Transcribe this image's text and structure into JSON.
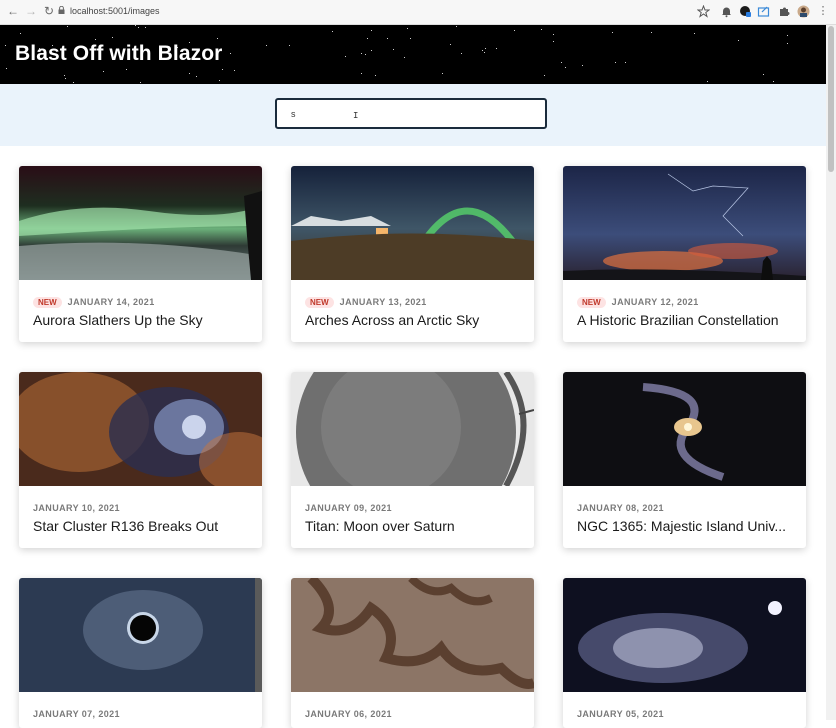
{
  "browser": {
    "url": "localhost:5001/images",
    "back_icon": "arrow-left-icon",
    "forward_icon": "arrow-right-icon",
    "reload_icon": "reload-icon"
  },
  "header": {
    "title": "Blast Off with Blazor"
  },
  "search": {
    "value": "s"
  },
  "cards": [
    {
      "badge": "NEW",
      "date": "JANUARY 14, 2021",
      "title": "Aurora Slathers Up the Sky"
    },
    {
      "badge": "NEW",
      "date": "JANUARY 13, 2021",
      "title": "Arches Across an Arctic Sky"
    },
    {
      "badge": "NEW",
      "date": "JANUARY 12, 2021",
      "title": "A Historic Brazilian Constellation"
    },
    {
      "badge": "",
      "date": "JANUARY 10, 2021",
      "title": "Star Cluster R136 Breaks Out"
    },
    {
      "badge": "",
      "date": "JANUARY 09, 2021",
      "title": "Titan: Moon over Saturn"
    },
    {
      "badge": "",
      "date": "JANUARY 08, 2021",
      "title": "NGC 1365: Majestic Island Univ..."
    },
    {
      "badge": "",
      "date": "JANUARY 07, 2021",
      "title": ""
    },
    {
      "badge": "",
      "date": "JANUARY 06, 2021",
      "title": ""
    },
    {
      "badge": "",
      "date": "JANUARY 05, 2021",
      "title": ""
    }
  ]
}
